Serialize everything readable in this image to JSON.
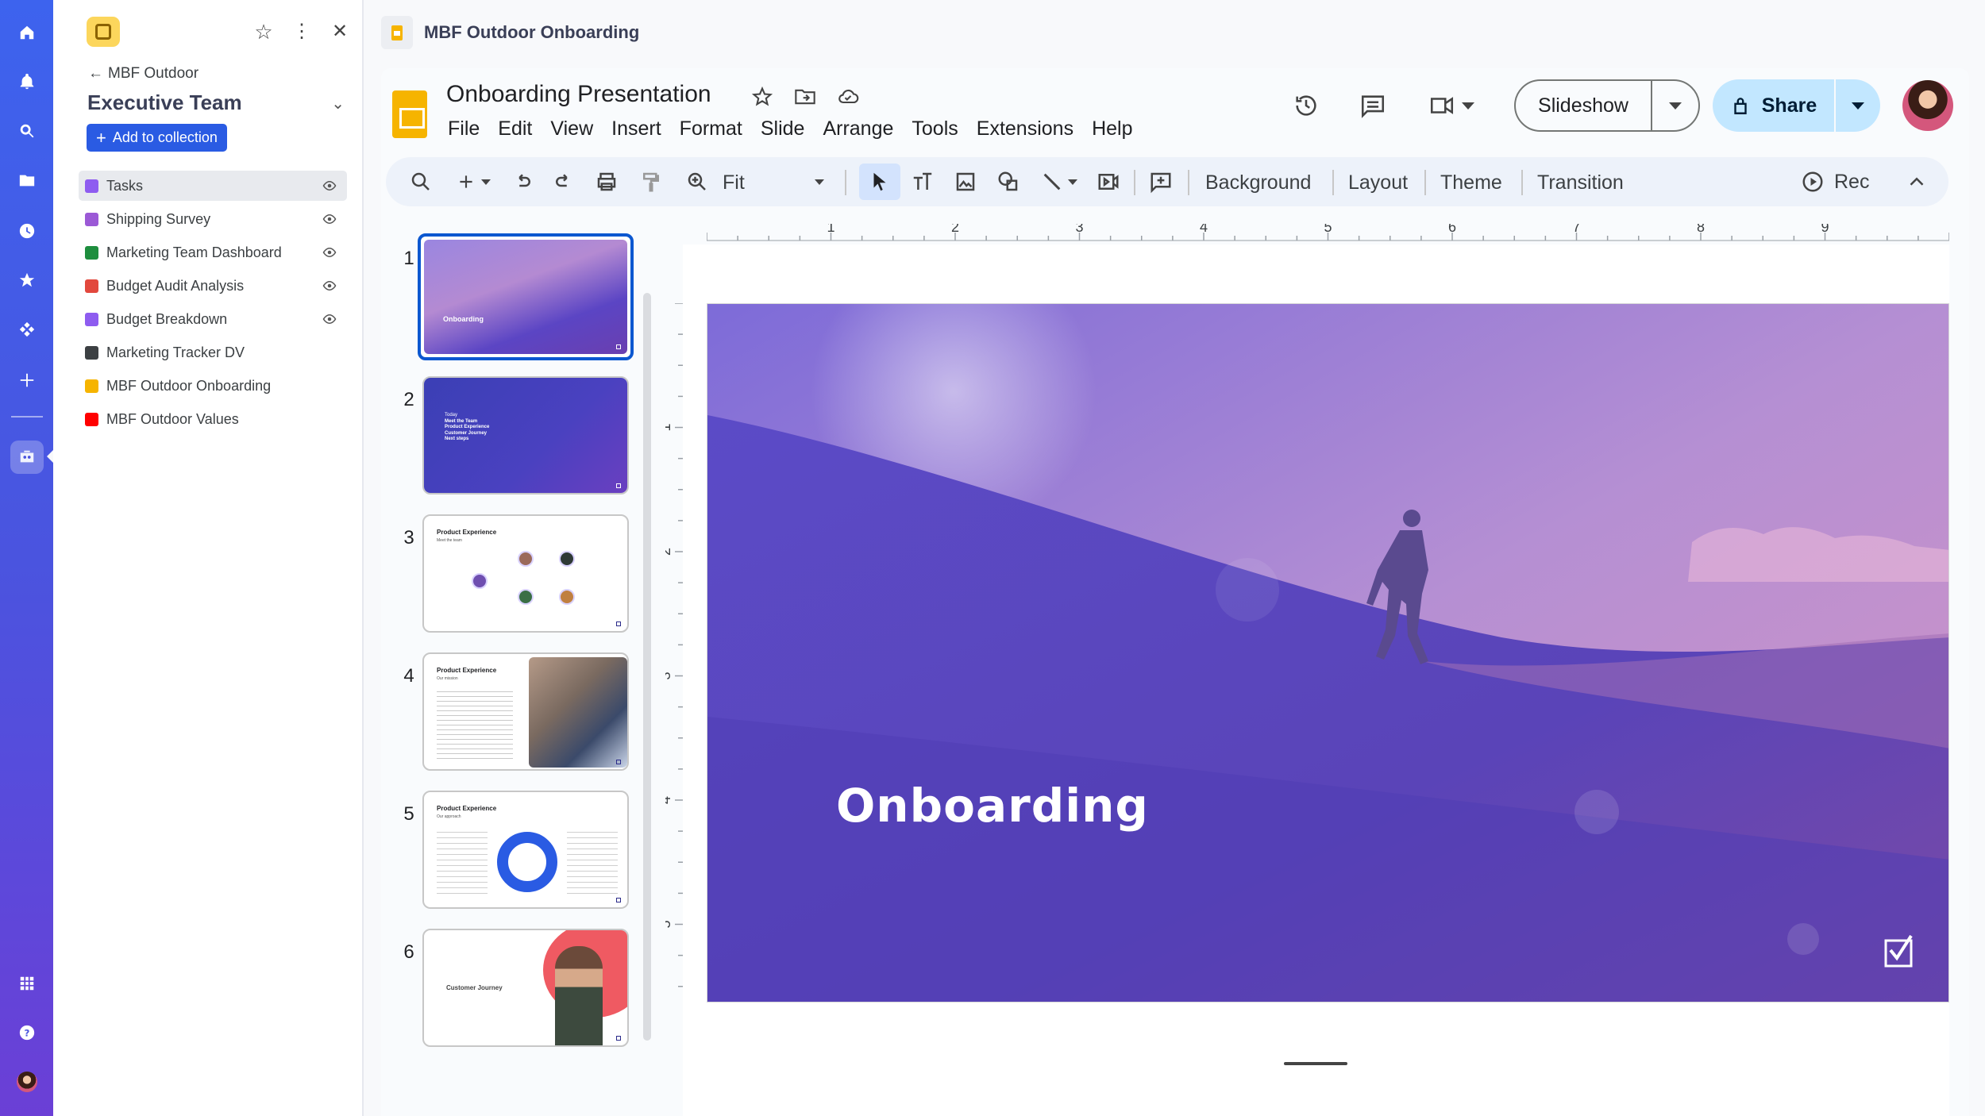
{
  "rail": {
    "items": [
      "home",
      "notifications",
      "search",
      "folder",
      "recent",
      "favorites",
      "integrations",
      "add",
      "collections",
      "apps",
      "help",
      "profile"
    ]
  },
  "panel": {
    "breadcrumb": "MBF Outdoor",
    "team_title": "Executive Team",
    "add_button": "Add to collection",
    "items": [
      {
        "label": "Tasks",
        "icon_color": "#8e5cf0",
        "eye": true,
        "active": true
      },
      {
        "label": "Shipping Survey",
        "icon_color": "#9b59d6",
        "eye": true,
        "active": false
      },
      {
        "label": "Marketing Team Dashboard",
        "icon_color": "#1e8e3e",
        "eye": true,
        "active": false
      },
      {
        "label": "Budget Audit Analysis",
        "icon_color": "#e2483d",
        "eye": true,
        "active": false
      },
      {
        "label": "Budget Breakdown",
        "icon_color": "#8e5cf0",
        "eye": true,
        "active": false
      },
      {
        "label": "Marketing Tracker DV",
        "icon_color": "#3c4043",
        "eye": false,
        "active": false
      },
      {
        "label": "MBF Outdoor Onboarding",
        "icon_color": "#f6b400",
        "eye": false,
        "active": false
      },
      {
        "label": "MBF Outdoor Values",
        "icon_color": "#ff0000",
        "eye": false,
        "active": false
      }
    ]
  },
  "tab_title": "MBF Outdoor Onboarding",
  "doc": {
    "name": "Onboarding Presentation",
    "menu": [
      "File",
      "Edit",
      "View",
      "Insert",
      "Format",
      "Slide",
      "Arrange",
      "Tools",
      "Extensions",
      "Help"
    ],
    "slideshow_label": "Slideshow",
    "share_label": "Share"
  },
  "toolbar": {
    "zoom_value": "Fit",
    "background_label": "Background",
    "layout_label": "Layout",
    "theme_label": "Theme",
    "transition_label": "Transition",
    "rec_label": "Rec"
  },
  "filmstrip": [
    {
      "num": "1",
      "title": "Onboarding"
    },
    {
      "num": "2",
      "title": "Today",
      "bullets": [
        "Meet the Team",
        "Product Experience",
        "Customer Journey",
        "Next steps"
      ]
    },
    {
      "num": "3",
      "title": "Product Experience",
      "subtitle": "Meet the team"
    },
    {
      "num": "4",
      "title": "Product Experience",
      "subtitle": "Our mission"
    },
    {
      "num": "5",
      "title": "Product Experience",
      "subtitle": "Our approach"
    },
    {
      "num": "6",
      "title": "Customer Journey"
    }
  ],
  "ruler": {
    "top_labels": [
      "1",
      "2",
      "3",
      "4",
      "5",
      "6",
      "7",
      "8",
      "9"
    ],
    "left_labels": [
      "1",
      "2",
      "3",
      "4",
      "5"
    ]
  },
  "slide": {
    "title": "Onboarding",
    "colors": {
      "top": "#b98fcf",
      "bottom": "#5b46c8",
      "accent": "#c673a8"
    }
  }
}
